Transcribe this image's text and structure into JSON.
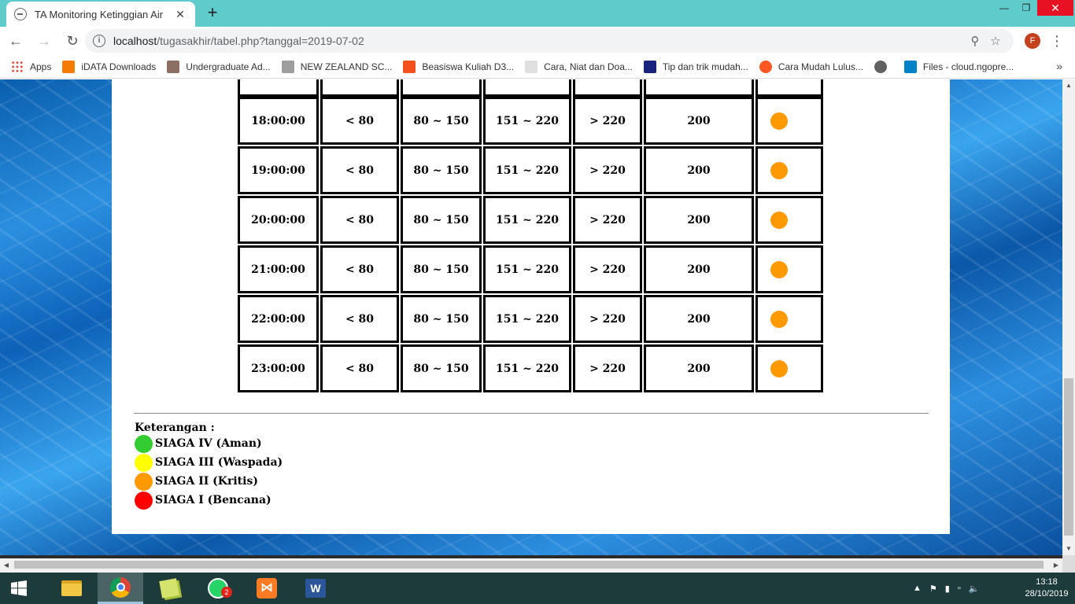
{
  "browser": {
    "tab_title": "TA Monitoring Ketinggian Air",
    "tab_close": "✕",
    "new_tab": "+",
    "url_host": "localhost",
    "url_path": "/tugasakhir/tabel.php?tanggal=2019-07-02",
    "profile_initial": "F"
  },
  "bookmarks": [
    {
      "label": "Apps",
      "icon": "apps-grid-icon",
      "color": "#e8453c"
    },
    {
      "label": "iDATA Downloads",
      "icon": "idata-icon",
      "color": "#f57c00"
    },
    {
      "label": "Undergraduate Ad...",
      "icon": "university-icon",
      "color": "#8d6e63"
    },
    {
      "label": "NEW ZEALAND SC...",
      "icon": "nz-crest-icon",
      "color": "#9e9e9e"
    },
    {
      "label": "Beasiswa Kuliah D3...",
      "icon": "beasiswa-icon",
      "color": "#f4511e"
    },
    {
      "label": "Cara, Niat dan Doa...",
      "icon": "page-icon",
      "color": "#e0e0e0"
    },
    {
      "label": "Tip dan trik mudah...",
      "icon": "r-logo-icon",
      "color": "#1a237e"
    },
    {
      "label": "Cara Mudah Lulus...",
      "icon": "ring-icon",
      "color": "#ff5722"
    },
    {
      "label": "",
      "icon": "globe-icon",
      "color": "#616161"
    },
    {
      "label": "Files - cloud.ngopre...",
      "icon": "nextcloud-icon",
      "color": "#0082c9"
    }
  ],
  "bookmarks_more": "»",
  "status_colors": {
    "aman": "#33cc33",
    "waspada": "#ffff00",
    "kritis": "#ff9900",
    "bencana": "#ff0000"
  },
  "table": {
    "rows": [
      {
        "time": "",
        "aman": "",
        "waspada": "",
        "kritis": "",
        "bencana": "",
        "level": "",
        "status": "none"
      },
      {
        "time": "18:00:00",
        "aman": "< 80",
        "waspada": "80 ~ 150",
        "kritis": "151 ~ 220",
        "bencana": "> 220",
        "level": "200",
        "status": "kritis"
      },
      {
        "time": "19:00:00",
        "aman": "< 80",
        "waspada": "80 ~ 150",
        "kritis": "151 ~ 220",
        "bencana": "> 220",
        "level": "200",
        "status": "kritis"
      },
      {
        "time": "20:00:00",
        "aman": "< 80",
        "waspada": "80 ~ 150",
        "kritis": "151 ~ 220",
        "bencana": "> 220",
        "level": "200",
        "status": "kritis"
      },
      {
        "time": "21:00:00",
        "aman": "< 80",
        "waspada": "80 ~ 150",
        "kritis": "151 ~ 220",
        "bencana": "> 220",
        "level": "200",
        "status": "kritis"
      },
      {
        "time": "22:00:00",
        "aman": "< 80",
        "waspada": "80 ~ 150",
        "kritis": "151 ~ 220",
        "bencana": "> 220",
        "level": "200",
        "status": "kritis"
      },
      {
        "time": "23:00:00",
        "aman": "< 80",
        "waspada": "80 ~ 150",
        "kritis": "151 ~ 220",
        "bencana": "> 220",
        "level": "200",
        "status": "kritis"
      }
    ]
  },
  "legend": {
    "title": "Keterangan :",
    "items": [
      {
        "label": "SIAGA IV (Aman)",
        "status": "aman"
      },
      {
        "label": "SIAGA III (Waspada)",
        "status": "waspada"
      },
      {
        "label": "SIAGA II (Kritis)",
        "status": "kritis"
      },
      {
        "label": "SIAGA I (Bencana)",
        "status": "bencana"
      }
    ]
  },
  "taskbar": {
    "apps": [
      {
        "name": "file-explorer-icon",
        "active": false
      },
      {
        "name": "chrome-icon",
        "active": true
      },
      {
        "name": "sticky-notes-icon",
        "active": false
      },
      {
        "name": "whatsapp-icon",
        "active": false,
        "badge": "2"
      },
      {
        "name": "xampp-icon",
        "active": false
      },
      {
        "name": "word-icon",
        "active": false
      }
    ],
    "time": "13:18",
    "date": "28/10/2019"
  }
}
